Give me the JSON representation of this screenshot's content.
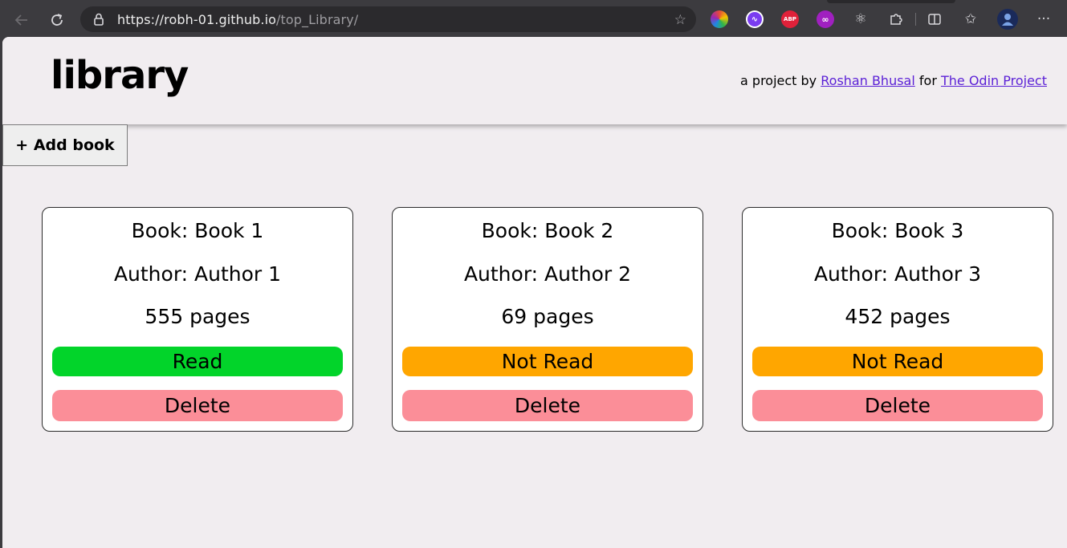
{
  "browser": {
    "url_host": "https://robh-01.github.io",
    "url_path": "/top_Library/",
    "extensions": [
      {
        "name": "color-wheel-icon",
        "label": "",
        "color": "#e64a3b"
      },
      {
        "name": "audio-extension-icon",
        "label": "",
        "color": "#7a3cf0"
      },
      {
        "name": "adblock-plus-icon",
        "label": "ABP",
        "color": "#e0213a"
      },
      {
        "name": "infinity-extension-icon",
        "label": "",
        "color": "#a020c0"
      }
    ]
  },
  "header": {
    "logo": "library",
    "credit_prefix": "a project by",
    "author_link": "Roshan Bhusal",
    "credit_mid": "for",
    "project_link": "The Odin Project"
  },
  "toolbar": {
    "add_label": "+ Add book"
  },
  "books": [
    {
      "title": "Book: Book 1",
      "author": "Author: Author 1",
      "pages": "555 pages",
      "status": "Read",
      "status_color": "#02d42a",
      "delete": "Delete"
    },
    {
      "title": "Book: Book 2",
      "author": "Author: Author 2",
      "pages": "69 pages",
      "status": "Not Read",
      "status_color": "#ffa600",
      "delete": "Delete"
    },
    {
      "title": "Book: Book 3",
      "author": "Author: Author 3",
      "pages": "452 pages",
      "status": "Not Read",
      "status_color": "#ffa600",
      "delete": "Delete"
    }
  ],
  "colors": {
    "read": "#02d42a",
    "not_read": "#ffa600",
    "delete": "#fb8e98",
    "page_bg": "#f1edf0"
  }
}
